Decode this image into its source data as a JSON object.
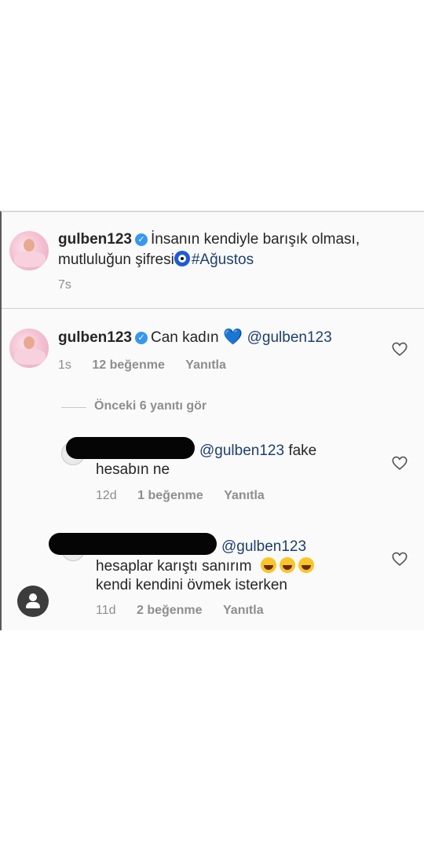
{
  "post": {
    "username": "gulben123",
    "caption_line1": "İnsanın kendiyle barışık olması,",
    "caption_line2_prefix": "mutluluğun şifresi",
    "caption_hashtag": "#Ağustos",
    "time": "7s"
  },
  "comment1": {
    "username": "gulben123",
    "text": "Can kadın",
    "mention": "@gulben123",
    "time": "1s",
    "likes": "12 beğenme",
    "reply_label": "Yanıtla"
  },
  "view_replies": "Önceki 6 yanıtı gör",
  "reply1": {
    "mention": "@gulben123",
    "text_suffix": "fake",
    "line2": "hesabın ne",
    "time": "12d",
    "likes": "1 beğenme",
    "reply_label": "Yanıtla"
  },
  "reply2": {
    "mention": "@gulben123",
    "line1": "hesaplar karıştı sanırım",
    "line2": "kendi kendini övmek isterken",
    "time": "11d",
    "likes": "2 beğenme",
    "reply_label": "Yanıtla"
  },
  "icons": {
    "heart": "heart-outline-icon",
    "verified": "verified-badge-icon",
    "profile": "person-icon"
  },
  "colors": {
    "link": "#1d3f6e",
    "verified": "#3897f0",
    "meta": "#8e8e8e"
  }
}
